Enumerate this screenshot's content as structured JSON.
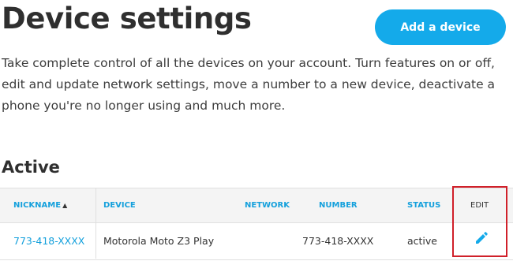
{
  "page": {
    "title": "Device settings",
    "add_button": "Add a device",
    "description": "Take complete control of all the devices on your account. Turn features on or off, edit and update network settings, move a number to a new device, deactivate a phone you're no longer using and much more."
  },
  "section": {
    "title": "Active"
  },
  "table": {
    "headers": {
      "nickname": "NICKNAME",
      "device": "DEVICE",
      "network": "NETWORK",
      "number": "NUMBER",
      "status": "STATUS",
      "edit": "EDIT"
    },
    "sort_indicator": "▲",
    "rows": [
      {
        "nickname": "773-418-XXXX",
        "device": "Motorola Moto Z3 Play",
        "network": "",
        "number": "773-418-XXXX",
        "status": "active",
        "edit_icon": "pencil-icon"
      }
    ]
  },
  "colors": {
    "accent": "#14aaea",
    "link": "#14a0dc",
    "highlight_border": "#d0202a"
  }
}
